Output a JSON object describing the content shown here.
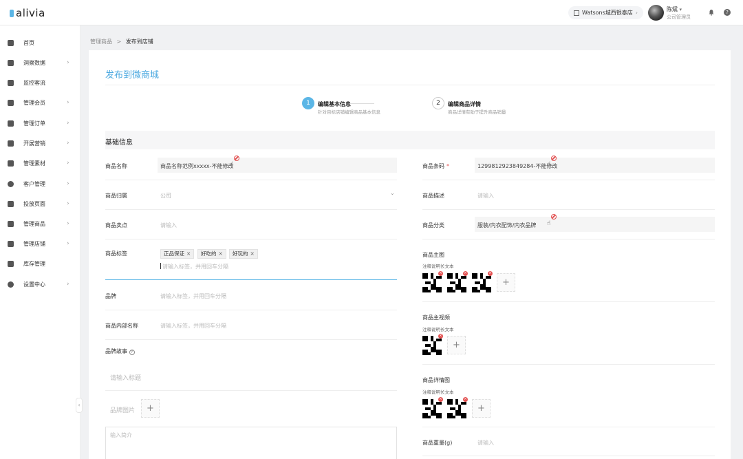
{
  "app": {
    "logo_text": "alivia",
    "brand_color": "#5bb6e6"
  },
  "header": {
    "store_name": "Watsons城西银泰店",
    "store_chevron": "›",
    "user_name": "陈斌",
    "user_caret": "▾",
    "user_role": "公司管理员",
    "help_glyph": "?"
  },
  "sidebar": {
    "items": [
      {
        "label": "首页",
        "arrow": ""
      },
      {
        "label": "洞察数据",
        "arrow": "›"
      },
      {
        "label": "监控客流",
        "arrow": ""
      },
      {
        "label": "管理会员",
        "arrow": "›"
      },
      {
        "label": "管理订单",
        "arrow": "›"
      },
      {
        "label": "开展营销",
        "arrow": "›"
      },
      {
        "label": "管理素材",
        "arrow": "›"
      },
      {
        "label": "客户管理",
        "arrow": "›"
      },
      {
        "label": "投放页面",
        "arrow": "›"
      },
      {
        "label": "管理商品",
        "arrow": "›"
      },
      {
        "label": "管理店铺",
        "arrow": "›"
      },
      {
        "label": "库存管理",
        "arrow": ""
      },
      {
        "label": "设置中心",
        "arrow": "›"
      }
    ],
    "collapse_glyph": "‹"
  },
  "breadcrumb": {
    "parent": "管理商品",
    "sep": ">",
    "current": "发布到店铺"
  },
  "page": {
    "title": "发布到微商城"
  },
  "steps": [
    {
      "num": "1",
      "title": "编辑基本信息",
      "sub": "针对目标店铺编辑商品基本信息"
    },
    {
      "num": "2",
      "title": "编辑商品详情",
      "sub": "商品详情有助于提升商品销量"
    }
  ],
  "section": {
    "title": "基础信息"
  },
  "left_form": {
    "name_label": "商品名称",
    "name_value": "商品名称范例xxxxx-不能修改",
    "owner_label": "商品归属",
    "owner_value": "公司",
    "owner_chevron": "⌄",
    "selling_label": "商品卖点",
    "selling_placeholder": "请输入",
    "tags_label": "商品标签",
    "tags": [
      {
        "text": "正品保证",
        "x": "×"
      },
      {
        "text": "好吃的",
        "x": "×"
      },
      {
        "text": "好玩的",
        "x": "×"
      }
    ],
    "tags_placeholder": "请输入标签，并用回车分隔",
    "brand_label": "品牌",
    "brand_placeholder": "请输入标签，并用回车分隔",
    "internal_label": "商品内部名称",
    "internal_placeholder": "请输入标签，并用回车分隔",
    "story_label": "品牌故事",
    "story_help": "?",
    "story_title_placeholder": "请输入标题",
    "brand_image_label": "品牌图片",
    "add_glyph": "+",
    "intro_placeholder": "输入简介"
  },
  "right_form": {
    "barcode_label": "商品条码",
    "required_mark": "*",
    "barcode_value": "1299812923849284-不能修改",
    "desc_label": "商品描述",
    "desc_placeholder": "请输入",
    "category_label": "商品分类",
    "category_value": "服装/内衣配饰/内衣品牌",
    "main_image_label": "商品主图",
    "main_image_note": "注释说明长文本",
    "main_video_label": "商品主视频",
    "main_video_note": "注释说明长文本",
    "detail_image_label": "商品详情图",
    "detail_image_note": "注释说明长文本",
    "weight_label": "商品重量(g)",
    "weight_placeholder": "请输入",
    "add_glyph": "+",
    "delete_glyph": "×"
  }
}
